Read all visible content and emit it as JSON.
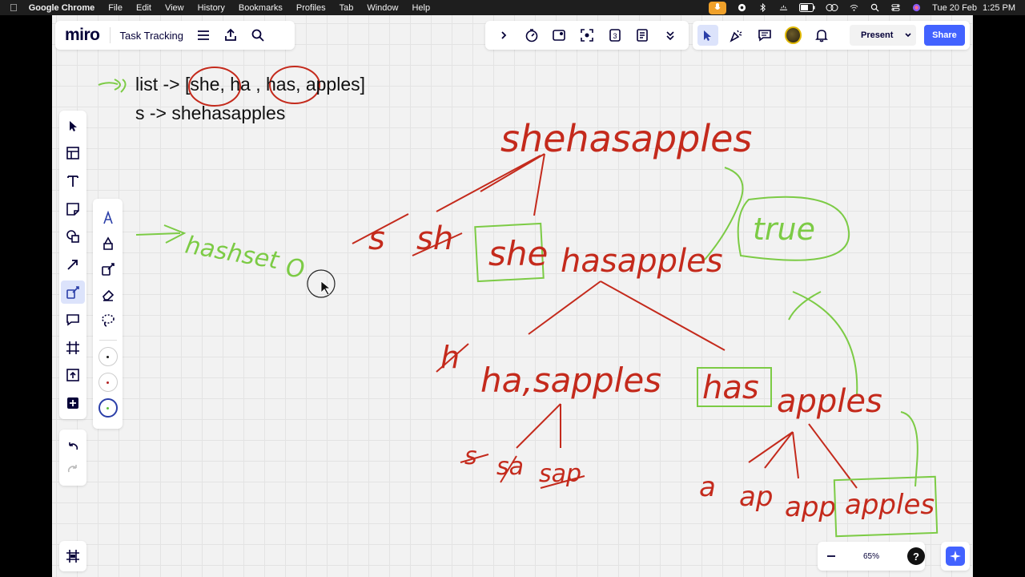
{
  "menubar": {
    "app": "Google Chrome",
    "items": [
      "File",
      "Edit",
      "View",
      "History",
      "Bookmarks",
      "Profiles",
      "Tab",
      "Window",
      "Help"
    ],
    "date": "Tue 20 Feb",
    "time": "1:25 PM"
  },
  "header": {
    "logo": "miro",
    "board_name": "Task Tracking",
    "present_label": "Present",
    "share_label": "Share"
  },
  "canvas": {
    "typed_lines": [
      "list -> [she, ha , has, apples]",
      "s -> shehasapples"
    ],
    "handwriting": {
      "left_note": "hashset",
      "left_zero": "O",
      "root": "shehasapples",
      "level1_crossed": [
        "s",
        "sh"
      ],
      "level1_word": "she",
      "level1_rest": "hasapples",
      "true_box": "true",
      "level2_crossed": "h",
      "level2_left": "ha,sapples",
      "level2_right_word": "has",
      "level2_right_rest": "apples",
      "level3_left": [
        "s",
        "sa",
        "sap"
      ],
      "level3_right": [
        "a",
        "ap",
        "app"
      ],
      "level3_right_word": "apples"
    }
  },
  "pen_colors": [
    "#1a1a1a",
    "#b22222",
    "#5cbf3a"
  ],
  "zoom": {
    "level": "65%"
  },
  "colors": {
    "accent": "#4262ff",
    "ink_red": "#c42a1c",
    "ink_green": "#7ccb45"
  }
}
